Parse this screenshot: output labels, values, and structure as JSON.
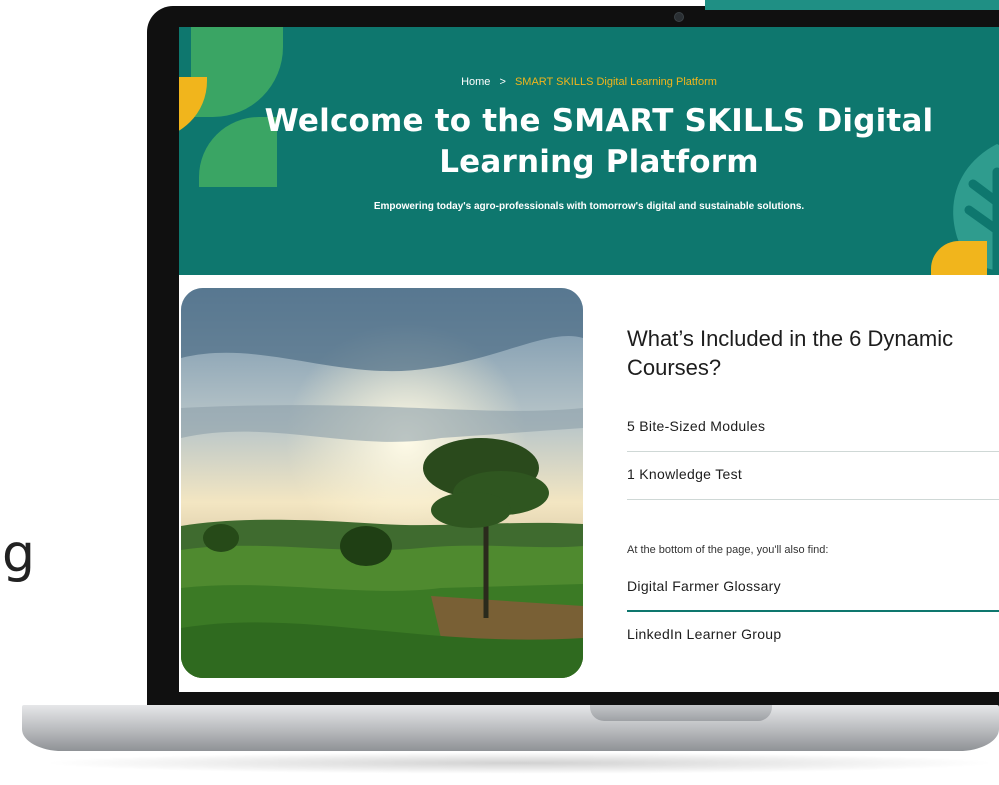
{
  "background_text": "g",
  "colors": {
    "hero_bg": "#0e776e",
    "accent_yellow": "#f1b51c",
    "leaf_green": "#3aa564",
    "text_dark": "#1d1d1d"
  },
  "breadcrumb": {
    "home": "Home",
    "separator": ">",
    "current": "SMART SKILLS Digital Learning Platform"
  },
  "hero": {
    "title": "Welcome to the SMART SKILLS Digital Learning Platform",
    "subtitle": "Empowering today's agro-professionals with tomorrow's digital and sustainable solutions."
  },
  "info": {
    "title": "What’s Included in the 6 Dynamic Courses?",
    "items": [
      "5 Bite-Sized Modules",
      "1 Knowledge Test"
    ],
    "note": "At the bottom of the page, you'll also find:",
    "extras": [
      "Digital Farmer Glossary",
      "LinkedIn Learner Group"
    ]
  },
  "icons": {
    "tree": "tree-icon",
    "camera": "camera-icon"
  }
}
